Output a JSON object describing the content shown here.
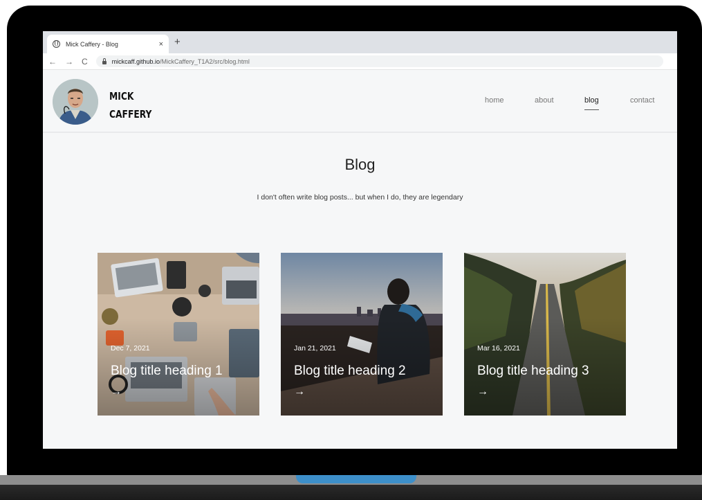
{
  "browser": {
    "tab_title": "Mick Caffery - Blog",
    "tab_close": "×",
    "new_tab": "+",
    "back": "←",
    "forward": "→",
    "reload": "C",
    "url_host": "mickcaff.github.io",
    "url_path": "/MickCaffery_T1A2/src/blog.html"
  },
  "header": {
    "brand_line1": "MICK",
    "brand_line2": "CAFFERY",
    "nav": [
      {
        "label": "home",
        "active": false
      },
      {
        "label": "about",
        "active": false
      },
      {
        "label": "blog",
        "active": true
      },
      {
        "label": "contact",
        "active": false
      }
    ]
  },
  "main": {
    "title": "Blog",
    "subtitle": "I don't often write blog posts... but when I do, they are legendary"
  },
  "cards": [
    {
      "date": "Dec 7, 2021",
      "heading": "Blog title heading 1",
      "arrow": "→"
    },
    {
      "date": "Jan 21, 2021",
      "heading": "Blog title heading 2",
      "arrow": "→"
    },
    {
      "date": "Mar 16, 2021",
      "heading": "Blog title heading 3",
      "arrow": "→"
    }
  ],
  "colors": {
    "page_bg": "#f6f7f8",
    "nav_active": "#222222",
    "nav_inactive": "#777777",
    "laptop_accent": "#3d8fc9"
  }
}
